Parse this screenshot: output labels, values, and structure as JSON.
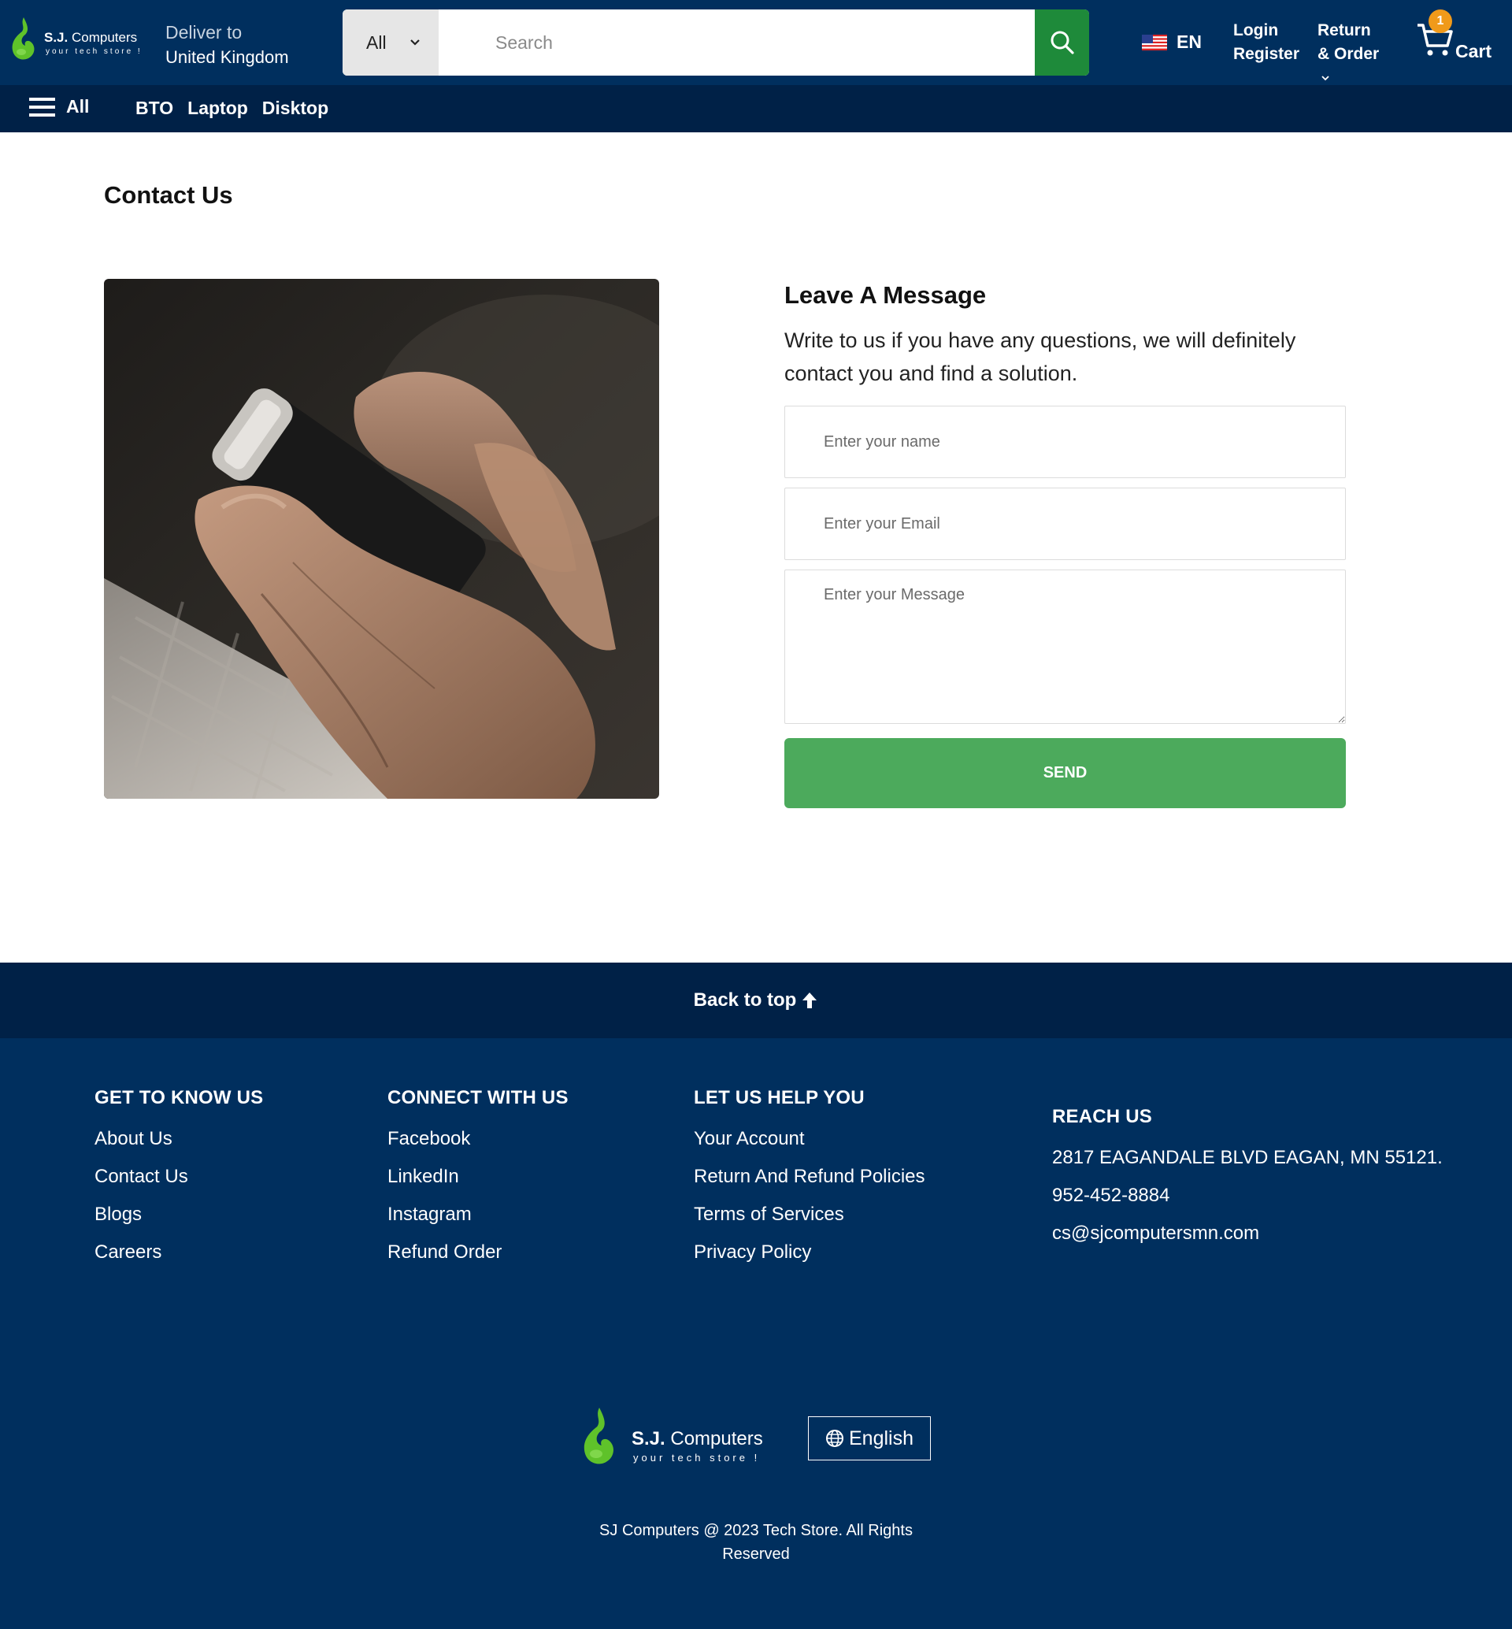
{
  "colors": {
    "header_bg": "#002f5e",
    "nav_bg": "#002147",
    "search_button": "#1e8a3a",
    "send_button": "#4caa5c",
    "cart_badge": "#f09a1a",
    "logo_green": "#5fc22a"
  },
  "header": {
    "logo": {
      "name_bold": "S.J.",
      "name_light": "Computers",
      "tagline": "your tech store !"
    },
    "deliver": {
      "label": "Deliver to",
      "country": "United Kingdom"
    },
    "search": {
      "category": "All",
      "placeholder": "Search",
      "icon": "search-icon"
    },
    "language": {
      "code": "EN",
      "icon": "us-flag-icon"
    },
    "account": {
      "login": "Login",
      "register": "Register"
    },
    "returns": {
      "line1": "Return",
      "line2": "& Order"
    },
    "cart": {
      "label": "Cart",
      "count": "1",
      "icon": "cart-icon"
    }
  },
  "nav": {
    "all_label": "All",
    "links": [
      "BTO",
      "Laptop",
      "Disktop"
    ]
  },
  "main": {
    "title": "Contact Us",
    "form": {
      "heading": "Leave A Message",
      "description": "Write to us if you have any questions, we will definitely contact you and find a solution.",
      "name_placeholder": "Enter your name",
      "email_placeholder": "Enter your Email",
      "message_placeholder": "Enter your Message",
      "send_label": "SEND"
    }
  },
  "back_to_top": "Back to top",
  "footer": {
    "columns": [
      {
        "heading": "GET TO KNOW US",
        "links": [
          "About Us",
          "Contact Us",
          "Blogs",
          "Careers"
        ]
      },
      {
        "heading": "CONNECT WITH US",
        "links": [
          "Facebook",
          "LinkedIn",
          "Instagram",
          "Refund Order"
        ]
      },
      {
        "heading": "LET US HELP YOU",
        "links": [
          "Your Account",
          "Return And Refund Policies",
          "Terms of Services",
          "Privacy Policy"
        ]
      }
    ],
    "reach": {
      "heading": "REACH US",
      "address": "2817 EAGANDALE BLVD EAGAN, MN 55121.",
      "phone": "952-452-8884",
      "email": "cs@sjcomputersmn.com"
    },
    "logo": {
      "name_bold": "S.J.",
      "name_light": "Computers",
      "tagline": "your tech store !"
    },
    "language_button": "English",
    "copyright_line1": "SJ Computers @ 2023 Tech Store. All Rights",
    "copyright_line2": "Reserved"
  }
}
